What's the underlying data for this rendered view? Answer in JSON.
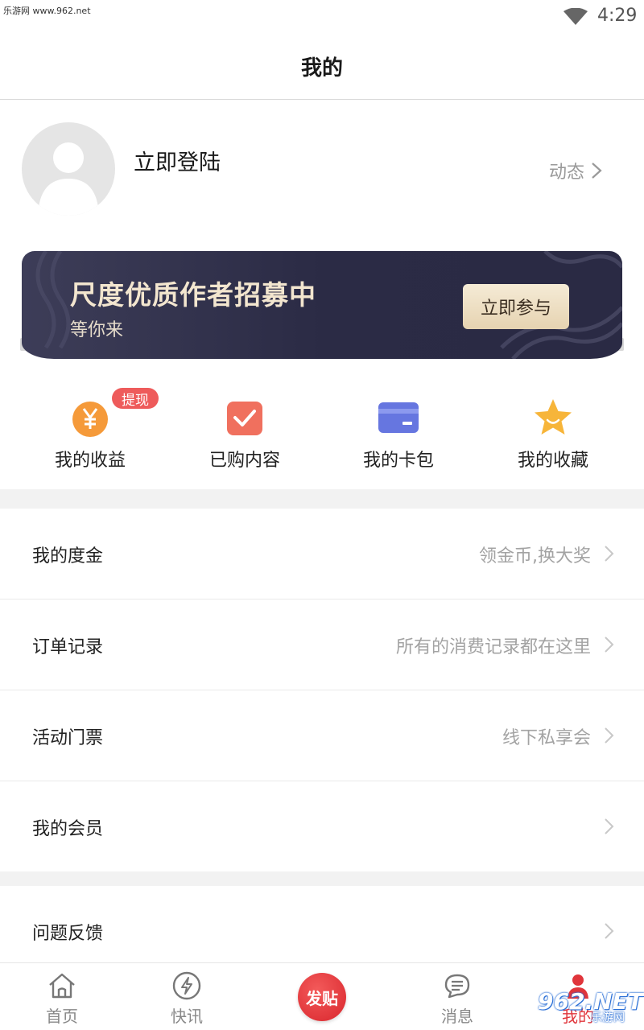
{
  "status_bar": {
    "watermark": "乐游网 www.962.net",
    "time": "4:29",
    "wifi_icon": "wifi-icon"
  },
  "header": {
    "title": "我的"
  },
  "profile": {
    "login_text": "立即登陆",
    "dynamic_label": "动态",
    "avatar_icon": "default-avatar-icon"
  },
  "banner": {
    "title": "尺度优质作者招募中",
    "subtitle": "等你来",
    "button_label": "立即参与"
  },
  "quick_actions": [
    {
      "label": "我的收益",
      "icon": "yuan-coin-icon",
      "badge": "提现",
      "color": "#f59a3a"
    },
    {
      "label": "已购内容",
      "icon": "check-box-icon",
      "color": "#f0705e"
    },
    {
      "label": "我的卡包",
      "icon": "card-icon",
      "color": "#6676e0"
    },
    {
      "label": "我的收藏",
      "icon": "star-icon",
      "color": "#f7b53a"
    }
  ],
  "menu": [
    {
      "label": "我的度金",
      "hint": "领金币,换大奖"
    },
    {
      "label": "订单记录",
      "hint": "所有的消费记录都在这里"
    },
    {
      "label": "活动门票",
      "hint": "线下私享会"
    },
    {
      "label": "我的会员",
      "hint": ""
    },
    {
      "label": "问题反馈",
      "hint": ""
    }
  ],
  "tab_bar": {
    "tabs": [
      {
        "label": "首页",
        "icon": "home-icon"
      },
      {
        "label": "快讯",
        "icon": "lightning-icon"
      },
      {
        "label": "消息",
        "icon": "message-icon"
      },
      {
        "label": "我的",
        "icon": "profile-icon"
      }
    ],
    "post_label": "发贴"
  },
  "corner_watermark": {
    "top": "962.NET",
    "bottom": "乐游网"
  },
  "colors": {
    "accent": "#e0353b",
    "banner_bg": "#2b2b45",
    "banner_text": "#f3e6cf"
  }
}
